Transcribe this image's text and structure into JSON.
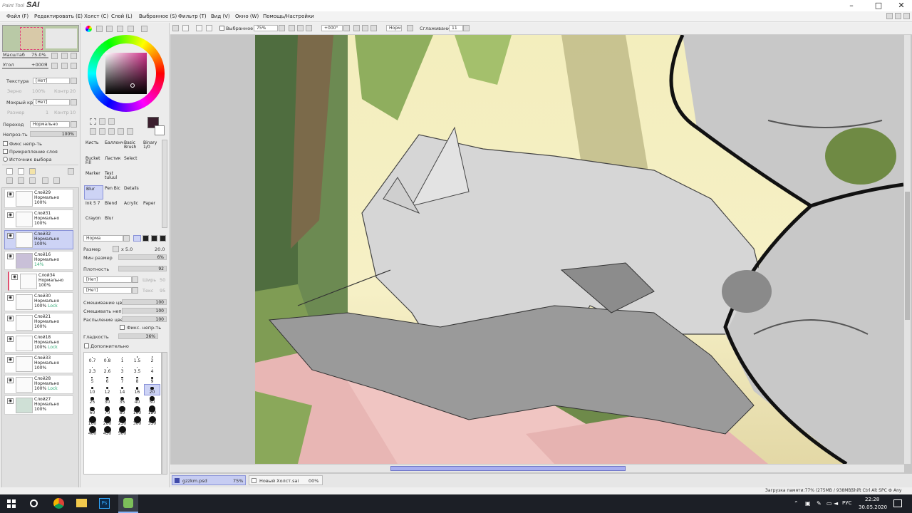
{
  "app": {
    "logo_small": "Paint Tool",
    "logo_big": "SAI"
  },
  "window_controls": {
    "minimize": "–",
    "maximize": "□",
    "close": "✕"
  },
  "menu": [
    "Файл (F)",
    "Редактировать (E)",
    "Холст (C)",
    "Слой (L)",
    "Выбранное (S)",
    "Фильтр (T)",
    "Вид (V)",
    "Окно (W)",
    "Помощь/Настройки"
  ],
  "navigator": {
    "zoom_label": "Масштаб",
    "zoom_value": "75.0%",
    "angle_label": "Угол",
    "angle_value": "+000Я"
  },
  "texture": {
    "label": "Текстура",
    "value": "[Нет]",
    "sub1": "Зерно",
    "sub1_val": "100%",
    "sub2": "Контр",
    "sub2_val": "20"
  },
  "wet_edge": {
    "label": "Мокрый край",
    "value": "[Нет]",
    "sub1": "Размер",
    "sub1_val": "1",
    "sub2": "Контр",
    "sub2_val": "10"
  },
  "blend": {
    "label": "Переход",
    "value": "Нормально"
  },
  "opacity": {
    "label": "Непроз-ть",
    "value": "100%"
  },
  "checks": [
    "Фикс непр-ть",
    "Прикрепление слоя",
    "Источник выбора"
  ],
  "layers": [
    {
      "name": "Слой29",
      "mode": "Нормально",
      "opacity": "100%",
      "lock": ""
    },
    {
      "name": "Слой31",
      "mode": "Нормально",
      "opacity": "100%",
      "lock": ""
    },
    {
      "name": "Слой32",
      "mode": "Нормально",
      "opacity": "100%",
      "lock": ""
    },
    {
      "name": "Слой16",
      "mode": "Нормально",
      "opacity": "14%",
      "lock": ""
    },
    {
      "name": "Слой34",
      "mode": "Нормально",
      "opacity": "100%",
      "lock": ""
    },
    {
      "name": "Слой30",
      "mode": "Нормально",
      "opacity": "100%",
      "lock": "Lock"
    },
    {
      "name": "Слой21",
      "mode": "Нормально",
      "opacity": "100%",
      "lock": ""
    },
    {
      "name": "Слой18",
      "mode": "Нормально",
      "opacity": "100%",
      "lock": "Lock"
    },
    {
      "name": "Слой33",
      "mode": "Нормально",
      "opacity": "100%",
      "lock": ""
    },
    {
      "name": "Слой28",
      "mode": "Нормально",
      "opacity": "100%",
      "lock": "Lock"
    },
    {
      "name": "Слой27",
      "mode": "Нормально",
      "opacity": "100%",
      "lock": ""
    }
  ],
  "tools": [
    [
      "Кисть",
      "Баллонч",
      "Basic Brush",
      "Binary 1/0"
    ],
    [
      "Bucket Fill",
      "Ластик",
      "Select",
      ""
    ],
    [
      "Marker",
      "Test tuluul",
      "",
      ""
    ],
    [
      "Blur",
      "Pen Bic",
      "Details",
      ""
    ],
    [
      "Ink 5 7",
      "Blend",
      "Acrylic",
      "Paper"
    ],
    [
      "Crayon",
      "Blur",
      "",
      ""
    ]
  ],
  "brush": {
    "mode": "Норма",
    "size_label": "Размер",
    "size_mult": "x 5.0",
    "size_value": "20.0",
    "min_size_label": "Мин размер",
    "min_size_value": "6%",
    "density_label": "Плотность",
    "density_value": "92",
    "shape1": "[Нет]",
    "shape2": "[Нет]",
    "shape1_r": "Ширь",
    "shape1_rv": "50",
    "shape2_r": "Текс",
    "shape2_rv": "95",
    "mix_label": "Смешивание цвет",
    "mix_value": "100",
    "dilute_label": "Смешивать непроз",
    "dilute_value": "100",
    "persist_label": "Распыление цвет",
    "persist_value": "100",
    "fix_opacity": "Фикс. непр-ть",
    "smooth_label": "Гладкость",
    "smooth_value": "36%",
    "advanced": "Дополнительно",
    "sizes": [
      "0.7",
      "0.8",
      "1",
      "1.5",
      "2",
      "2.3",
      "2.6",
      "3",
      "3.5",
      "4",
      "5",
      "6",
      "7",
      "8",
      "9",
      "10",
      "12",
      "14",
      "16",
      "20",
      "25",
      "30",
      "35",
      "40",
      "50",
      "60",
      "70",
      "80",
      "100",
      "120",
      "160",
      "200",
      "250",
      "300",
      "350",
      "400",
      "450",
      "500"
    ]
  },
  "canvas_toolbar": {
    "selection": "Выбранное",
    "zoom": "75%",
    "angle": "+000°",
    "blend": "Норм",
    "stab_label": "Сглаживание",
    "stab_value": "11"
  },
  "doc_tabs": [
    {
      "name": "gzzkm.psd",
      "zoom": "75%"
    },
    {
      "name": "Новый Холст.sai",
      "zoom": "00%"
    }
  ],
  "status": {
    "memory": "Загрузка памяти:77% (275MB / 938MB)",
    "keys": "Shift Ctrl Alt SPC ⚙ Any"
  },
  "taskbar": {
    "lang": "РУС",
    "time": "22:28",
    "date": "30.05.2020"
  },
  "colors": {
    "current": "#3b1f2e",
    "accent": "#8a93d8"
  }
}
